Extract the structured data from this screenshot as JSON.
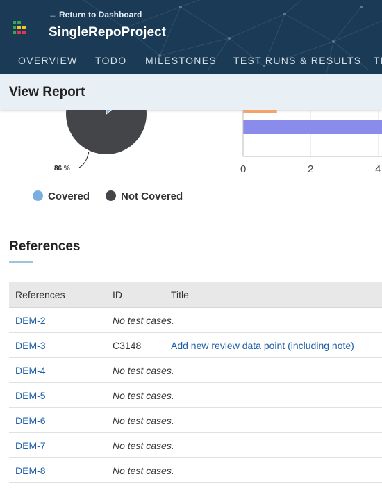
{
  "header": {
    "return_label": "Return to Dashboard",
    "project_name": "SingleRepoProject",
    "nav_tabs": [
      "OVERVIEW",
      "TODO",
      "MILESTONES",
      "TEST RUNS & RESULTS",
      "TE"
    ]
  },
  "subheader": {
    "title": "View Report"
  },
  "coverage_chart": {
    "not_covered_label": "86",
    "percent_sign": "%",
    "legend": [
      "Covered",
      "Not Covered"
    ],
    "colors": {
      "covered": "#7aaee3",
      "not_covered": "#444549"
    }
  },
  "chart_data": [
    {
      "type": "pie",
      "labels": [
        "Covered",
        "Not Covered"
      ],
      "values": [
        14,
        86
      ],
      "colors": [
        "#7aaee3",
        "#444549"
      ]
    },
    {
      "type": "bar",
      "orientation": "horizontal",
      "series": [
        {
          "values": [
            1
          ],
          "color": "#f4a46a"
        },
        {
          "values": [
            5
          ],
          "color": "#8a8cec"
        }
      ],
      "x_ticks": [
        "0",
        "2",
        "4"
      ],
      "xlim": [
        0,
        4.6
      ]
    }
  ],
  "references": {
    "heading": "References",
    "columns": [
      "References",
      "ID",
      "Title"
    ],
    "rows": [
      {
        "ref": "DEM-2",
        "id": "",
        "title": "No test cases."
      },
      {
        "ref": "DEM-3",
        "id": "C3148",
        "title": "Add new review data point (including note)"
      },
      {
        "ref": "DEM-4",
        "id": "",
        "title": "No test cases."
      },
      {
        "ref": "DEM-5",
        "id": "",
        "title": "No test cases."
      },
      {
        "ref": "DEM-6",
        "id": "",
        "title": "No test cases."
      },
      {
        "ref": "DEM-7",
        "id": "",
        "title": "No test cases."
      },
      {
        "ref": "DEM-8",
        "id": "",
        "title": "No test cases."
      }
    ]
  }
}
